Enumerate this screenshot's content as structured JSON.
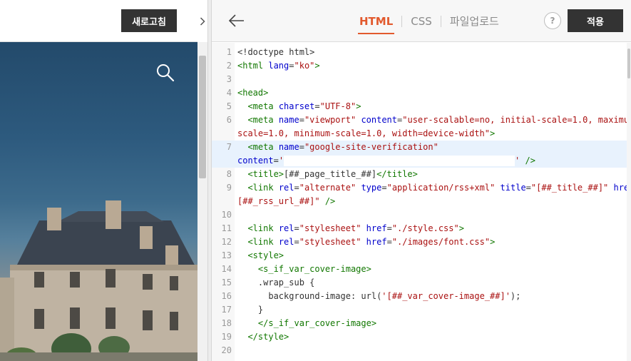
{
  "preview": {
    "refresh_label": "새로고침",
    "search_icon": "search-icon"
  },
  "editor": {
    "back_icon": "arrow-left-icon",
    "tabs": [
      {
        "label": "HTML",
        "active": true
      },
      {
        "label": "CSS",
        "active": false
      },
      {
        "label": "파일업로드",
        "active": false
      }
    ],
    "help_label": "?",
    "apply_label": "적용",
    "accent_color": "#e25a2e",
    "lines": [
      {
        "n": "1",
        "parts": [
          [
            "t-plain",
            "<!doctype html>"
          ]
        ]
      },
      {
        "n": "2",
        "parts": [
          [
            "t-tag",
            "<html"
          ],
          [
            "t-plain",
            " "
          ],
          [
            "t-attr",
            "lang"
          ],
          [
            "t-plain",
            "="
          ],
          [
            "t-str",
            "\"ko\""
          ],
          [
            "t-tag",
            ">"
          ]
        ]
      },
      {
        "n": "3",
        "parts": []
      },
      {
        "n": "4",
        "parts": [
          [
            "t-tag",
            "<head>"
          ]
        ]
      },
      {
        "n": "5",
        "parts": [
          [
            "t-plain",
            "  "
          ],
          [
            "t-tag",
            "<meta"
          ],
          [
            "t-plain",
            " "
          ],
          [
            "t-attr",
            "charset"
          ],
          [
            "t-plain",
            "="
          ],
          [
            "t-str",
            "\"UTF-8\""
          ],
          [
            "t-tag",
            ">"
          ]
        ]
      },
      {
        "n": "6",
        "parts": [
          [
            "t-plain",
            "  "
          ],
          [
            "t-tag",
            "<meta"
          ],
          [
            "t-plain",
            " "
          ],
          [
            "t-attr",
            "name"
          ],
          [
            "t-plain",
            "="
          ],
          [
            "t-str",
            "\"viewport\""
          ],
          [
            "t-plain",
            " "
          ],
          [
            "t-attr",
            "content"
          ],
          [
            "t-plain",
            "="
          ],
          [
            "t-str",
            "\"user-scalable=no, initial-scale=1.0, maximum-"
          ]
        ]
      },
      {
        "n": "",
        "parts": [
          [
            "t-str",
            "scale=1.0, minimum-scale=1.0, width=device-width\""
          ],
          [
            "t-tag",
            ">"
          ]
        ]
      },
      {
        "n": "7",
        "parts": [
          [
            "t-plain",
            "  "
          ],
          [
            "t-tag",
            "<meta"
          ],
          [
            "t-plain",
            " "
          ],
          [
            "t-attr",
            "name"
          ],
          [
            "t-plain",
            "="
          ],
          [
            "t-str",
            "\"google-site-verification\""
          ]
        ]
      },
      {
        "n": "",
        "parts": [
          [
            "t-attr",
            "content"
          ],
          [
            "t-plain",
            "="
          ],
          [
            "t-str",
            "'"
          ],
          [
            "redacted",
            ""
          ],
          [
            "t-str",
            "'"
          ],
          [
            "t-plain",
            " "
          ],
          [
            "t-tag",
            "/>"
          ]
        ]
      },
      {
        "n": "8",
        "parts": [
          [
            "t-plain",
            "  "
          ],
          [
            "t-tag",
            "<title>"
          ],
          [
            "t-plain",
            "[##_page_title_##]"
          ],
          [
            "t-tag",
            "</title>"
          ]
        ]
      },
      {
        "n": "9",
        "parts": [
          [
            "t-plain",
            "  "
          ],
          [
            "t-tag",
            "<link"
          ],
          [
            "t-plain",
            " "
          ],
          [
            "t-attr",
            "rel"
          ],
          [
            "t-plain",
            "="
          ],
          [
            "t-str",
            "\"alternate\""
          ],
          [
            "t-plain",
            " "
          ],
          [
            "t-attr",
            "type"
          ],
          [
            "t-plain",
            "="
          ],
          [
            "t-str",
            "\"application/rss+xml\""
          ],
          [
            "t-plain",
            " "
          ],
          [
            "t-attr",
            "title"
          ],
          [
            "t-plain",
            "="
          ],
          [
            "t-str",
            "\"[##_title_##]\""
          ],
          [
            "t-plain",
            " "
          ],
          [
            "t-attr",
            "href"
          ],
          [
            "t-plain",
            "="
          ],
          [
            "t-str",
            "\""
          ]
        ]
      },
      {
        "n": "",
        "parts": [
          [
            "t-str",
            "[##_rss_url_##]\""
          ],
          [
            "t-plain",
            " "
          ],
          [
            "t-tag",
            "/>"
          ]
        ]
      },
      {
        "n": "10",
        "parts": []
      },
      {
        "n": "11",
        "parts": [
          [
            "t-plain",
            "  "
          ],
          [
            "t-tag",
            "<link"
          ],
          [
            "t-plain",
            " "
          ],
          [
            "t-attr",
            "rel"
          ],
          [
            "t-plain",
            "="
          ],
          [
            "t-str",
            "\"stylesheet\""
          ],
          [
            "t-plain",
            " "
          ],
          [
            "t-attr",
            "href"
          ],
          [
            "t-plain",
            "="
          ],
          [
            "t-str",
            "\"./style.css\""
          ],
          [
            "t-tag",
            ">"
          ]
        ]
      },
      {
        "n": "12",
        "parts": [
          [
            "t-plain",
            "  "
          ],
          [
            "t-tag",
            "<link"
          ],
          [
            "t-plain",
            " "
          ],
          [
            "t-attr",
            "rel"
          ],
          [
            "t-plain",
            "="
          ],
          [
            "t-str",
            "\"stylesheet\""
          ],
          [
            "t-plain",
            " "
          ],
          [
            "t-attr",
            "href"
          ],
          [
            "t-plain",
            "="
          ],
          [
            "t-str",
            "\"./images/font.css\""
          ],
          [
            "t-tag",
            ">"
          ]
        ]
      },
      {
        "n": "13",
        "parts": [
          [
            "t-plain",
            "  "
          ],
          [
            "t-tag",
            "<style>"
          ]
        ]
      },
      {
        "n": "14",
        "parts": [
          [
            "t-plain",
            "    "
          ],
          [
            "t-tag",
            "<s_if_var_cover-image>"
          ]
        ]
      },
      {
        "n": "15",
        "parts": [
          [
            "t-plain",
            "    .wrap_sub {"
          ]
        ]
      },
      {
        "n": "16",
        "parts": [
          [
            "t-plain",
            "      background-image: url("
          ],
          [
            "t-str",
            "'[##_var_cover-image_##]'"
          ],
          [
            "t-plain",
            ");"
          ]
        ]
      },
      {
        "n": "17",
        "parts": [
          [
            "t-plain",
            "    }"
          ]
        ]
      },
      {
        "n": "18",
        "parts": [
          [
            "t-plain",
            "    "
          ],
          [
            "t-tag",
            "</s_if_var_cover-image>"
          ]
        ]
      },
      {
        "n": "19",
        "parts": [
          [
            "t-plain",
            "  "
          ],
          [
            "t-tag",
            "</style>"
          ]
        ]
      },
      {
        "n": "20",
        "parts": []
      }
    ]
  }
}
